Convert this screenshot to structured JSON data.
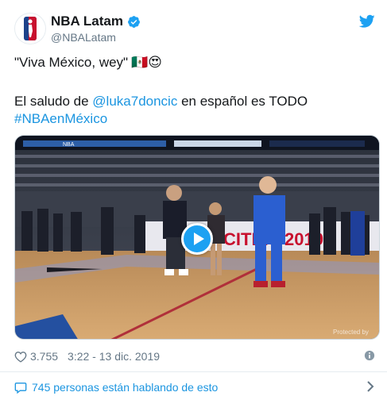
{
  "account": {
    "name": "NBA Latam",
    "handle": "@NBALatam"
  },
  "tweet": {
    "line1": "\"Viva México, wey\"",
    "line1_emojis": "🇲🇽😍",
    "line2_prefix": "El saludo de ",
    "line2_mention": "@luka7doncic",
    "line2_suffix": " en español es TODO",
    "hashtag": "#NBAenMéxico"
  },
  "media": {
    "kind": "video",
    "scoreboard": "NBA",
    "banner_text": "CITIES 2019",
    "watermark": "Protected by"
  },
  "meta": {
    "likes": "3.755",
    "timestamp": "3:22 - 13 dic. 2019"
  },
  "footer": {
    "conversation": "745 personas están hablando de esto"
  },
  "colors": {
    "brand_blue": "#1da1f2",
    "link_blue": "#1b95e0",
    "secondary_text": "#657786"
  },
  "icons": [
    "nba-logo-icon",
    "verified-badge-icon",
    "twitter-bird-icon",
    "play-icon",
    "heart-icon",
    "info-icon",
    "speech-bubble-icon",
    "chevron-right-icon"
  ]
}
